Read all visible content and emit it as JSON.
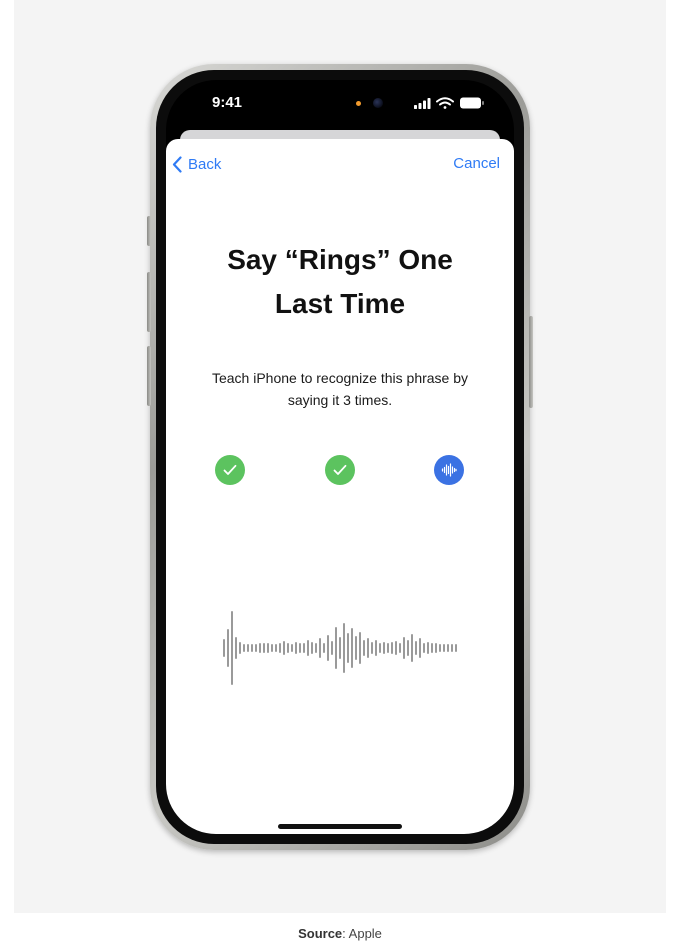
{
  "status_bar": {
    "time": "9:41"
  },
  "nav": {
    "back_label": "Back",
    "cancel_label": "Cancel"
  },
  "content": {
    "title_line1": "Say “Rings” One",
    "title_line2": "Last Time",
    "instructions_line1": "Teach iPhone to recognize this phrase by",
    "instructions_line2": "saying it 3 times."
  },
  "progress": {
    "total_steps": 3,
    "completed_steps": 2,
    "steps": [
      {
        "state": "completed",
        "icon": "checkmark-icon"
      },
      {
        "state": "completed",
        "icon": "checkmark-icon"
      },
      {
        "state": "listening",
        "icon": "waveform-icon"
      }
    ]
  },
  "caption": {
    "source_label": "Source",
    "source_value": ": Apple"
  },
  "colors": {
    "accent_blue": "#2f7bf5",
    "completed_green": "#5cc35f",
    "active_blue": "#3b72e3",
    "waveform_gray": "#9a9a9a"
  }
}
